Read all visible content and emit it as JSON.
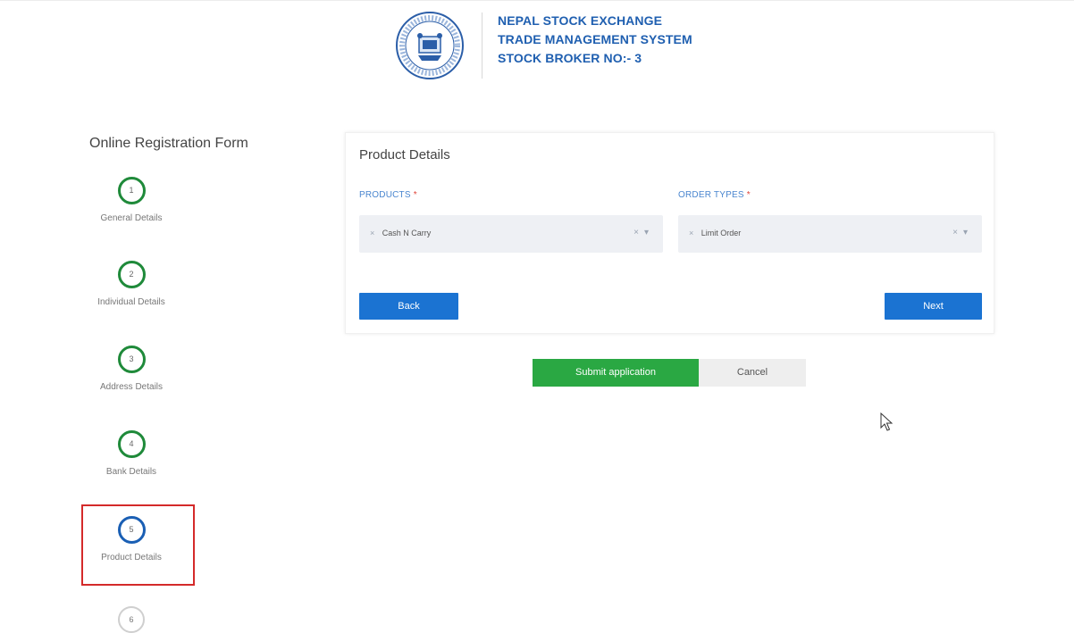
{
  "header": {
    "line1": "NEPAL STOCK EXCHANGE",
    "line2": "TRADE MANAGEMENT SYSTEM",
    "line3": "STOCK BROKER NO:- 3",
    "logo_label": "NEPAL STOCK EXCHANGE LTD. 1993"
  },
  "sidebar": {
    "title": "Online Registration Form",
    "steps": [
      {
        "number": "1",
        "label": "General Details",
        "state": "done"
      },
      {
        "number": "2",
        "label": "Individual Details",
        "state": "done"
      },
      {
        "number": "3",
        "label": "Address Details",
        "state": "done"
      },
      {
        "number": "4",
        "label": "Bank Details",
        "state": "done"
      },
      {
        "number": "5",
        "label": "Product Details",
        "state": "active"
      },
      {
        "number": "6",
        "label": "",
        "state": "pending"
      }
    ]
  },
  "card": {
    "title": "Product Details",
    "products_label": "PRODUCTS",
    "order_types_label": "ORDER TYPES",
    "required_mark": "*",
    "products_value": "Cash N Carry",
    "order_types_value": "Limit Order",
    "back_label": "Back",
    "next_label": "Next"
  },
  "actions": {
    "submit_label": "Submit application",
    "cancel_label": "Cancel"
  },
  "colors": {
    "brand_blue": "#1f5fb0",
    "primary_button": "#1b73d2",
    "success_green": "#2aa843",
    "step_done": "#1f8a3a",
    "step_active": "#1a5fb4",
    "highlight_red": "#d42a2a"
  }
}
